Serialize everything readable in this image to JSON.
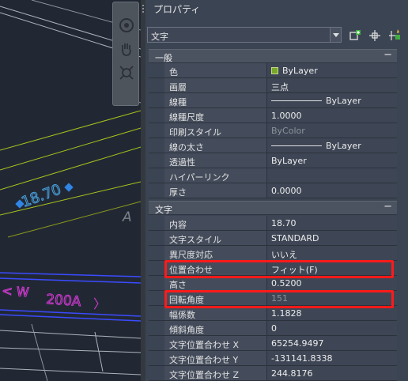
{
  "palette": {
    "title": "プロパティ",
    "selection": "文字"
  },
  "drawing": {
    "dimension_text": "18.70",
    "label_w": "< W",
    "label_200a": "200A",
    "label_a": "A",
    "label_arrow": "〉"
  },
  "sections": {
    "general": {
      "label": "一般",
      "toggle": "−",
      "rows": [
        {
          "name": "色",
          "value": "ByLayer",
          "swatch": "#77a82a"
        },
        {
          "name": "画層",
          "value": "三点"
        },
        {
          "name": "線種",
          "value": "ByLayer"
        },
        {
          "name": "線種尺度",
          "value": "1.0000"
        },
        {
          "name": "印刷スタイル",
          "value": "ByColor"
        },
        {
          "name": "線の太さ",
          "value": "ByLayer"
        },
        {
          "name": "透過性",
          "value": "ByLayer"
        },
        {
          "name": "ハイパーリンク",
          "value": ""
        },
        {
          "name": "厚さ",
          "value": "0.0000"
        }
      ]
    },
    "text": {
      "label": "文字",
      "toggle": "−",
      "rows": [
        {
          "name": "内容",
          "value": "18.70"
        },
        {
          "name": "文字スタイル",
          "value": "STANDARD"
        },
        {
          "name": "異尺度対応",
          "value": "いいえ"
        },
        {
          "name": "位置合わせ",
          "value": "フィット(F)"
        },
        {
          "name": "高さ",
          "value": "0.5200"
        },
        {
          "name": "回転角度",
          "value": "151"
        },
        {
          "name": "幅係数",
          "value": "1.1828"
        },
        {
          "name": "傾斜角度",
          "value": "0"
        },
        {
          "name": "文字位置合わせ X",
          "value": "65254.9497"
        },
        {
          "name": "文字位置合わせ Y",
          "value": "-131141.8338"
        },
        {
          "name": "文字位置合わせ Z",
          "value": "244.8176"
        }
      ]
    }
  },
  "colors": {
    "highlight": "#ff1a1a",
    "layer_green": "#77a82a",
    "dimension_blue": "#4aa3e0",
    "magenta": "#d13ad1"
  }
}
